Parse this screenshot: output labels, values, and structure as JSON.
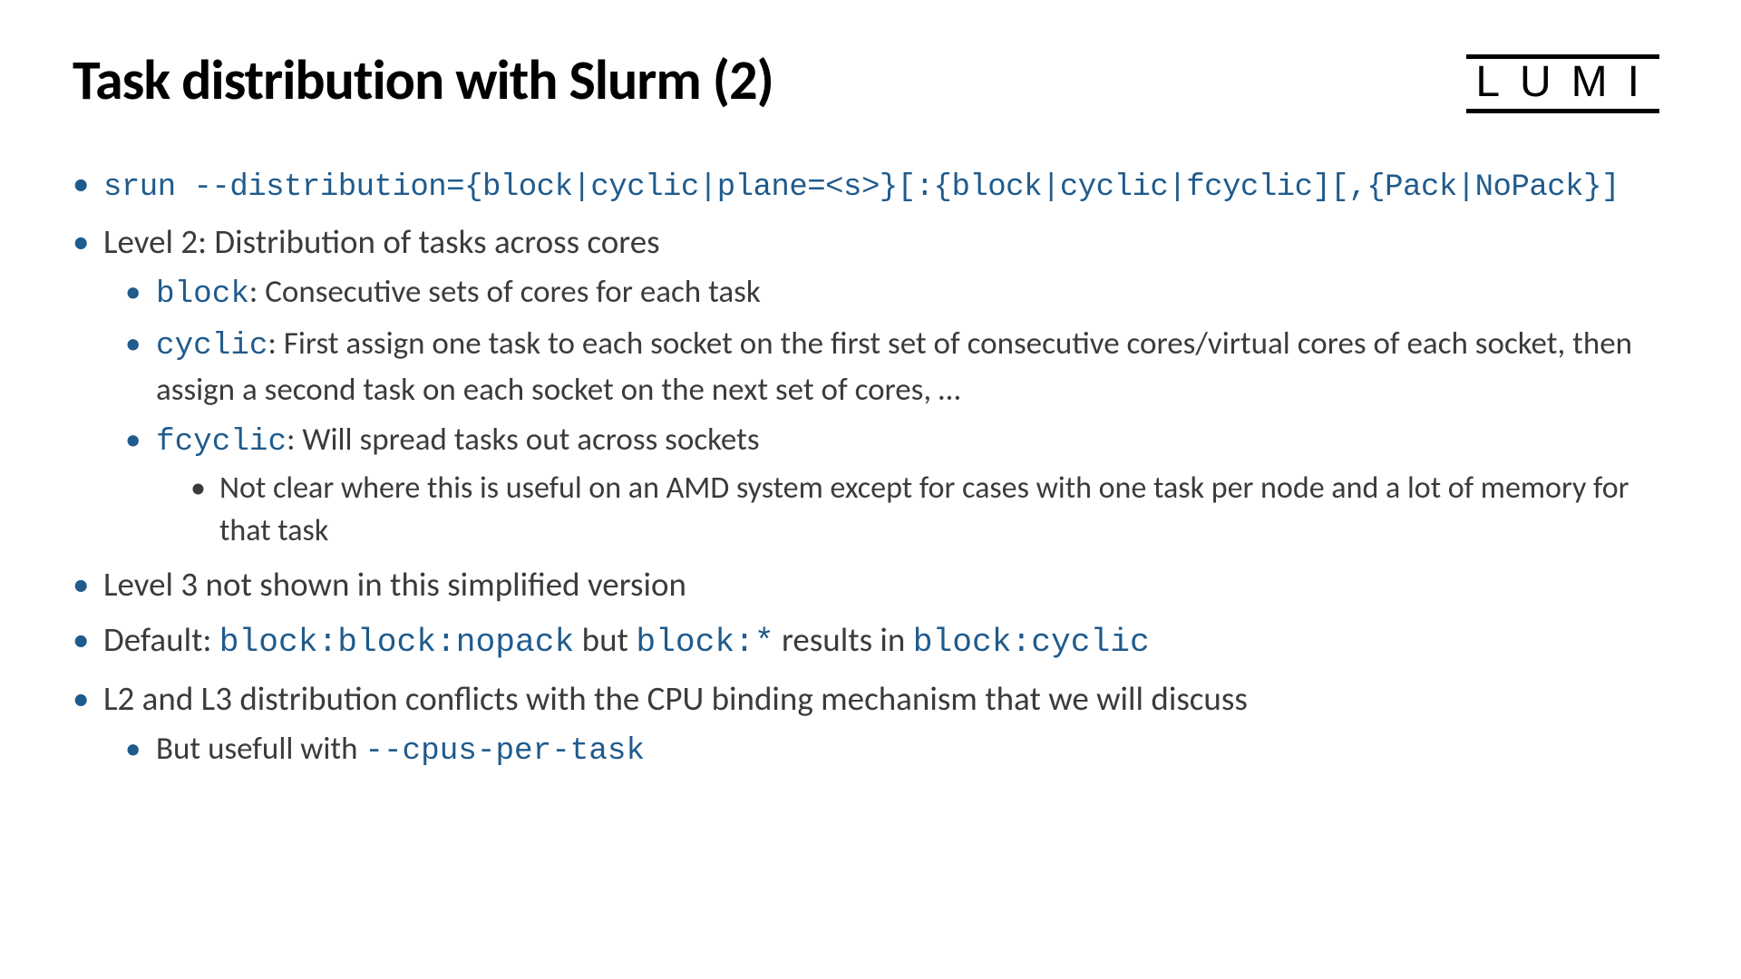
{
  "title": "Task distribution with Slurm (2)",
  "logo": "LUMI",
  "bullets": {
    "b1_code": "srun --distribution={block|cyclic|plane=<s>}[:{block|cyclic|fcyclic][,{Pack|NoPack}]",
    "b2": "Level 2: Distribution of tasks across cores",
    "b2_1_code": "block",
    "b2_1_text": ": Consecutive sets of cores for each task",
    "b2_2_code": "cyclic",
    "b2_2_text": ": First assign one task to each socket on the first set of consecutive cores/virtual cores of each socket, then assign a second task on each socket on the next set of cores, …",
    "b2_3_code": "fcyclic",
    "b2_3_text": ": Will spread tasks out across sockets",
    "b2_3_1": "Not clear where this is useful on an AMD system except for cases with one task per node and a lot of memory for that task",
    "b3": "Level 3 not shown in this simplified version",
    "b4_pre": "Default: ",
    "b4_code1": "block:block:nopack",
    "b4_mid": " but ",
    "b4_code2": "block:*",
    "b4_mid2": " results in ",
    "b4_code3": "block:cyclic",
    "b5": "L2 and L3 distribution conflicts with the CPU binding mechanism that we will discuss",
    "b5_1_pre": "But usefull with ",
    "b5_1_code": "--cpus-per-task"
  }
}
